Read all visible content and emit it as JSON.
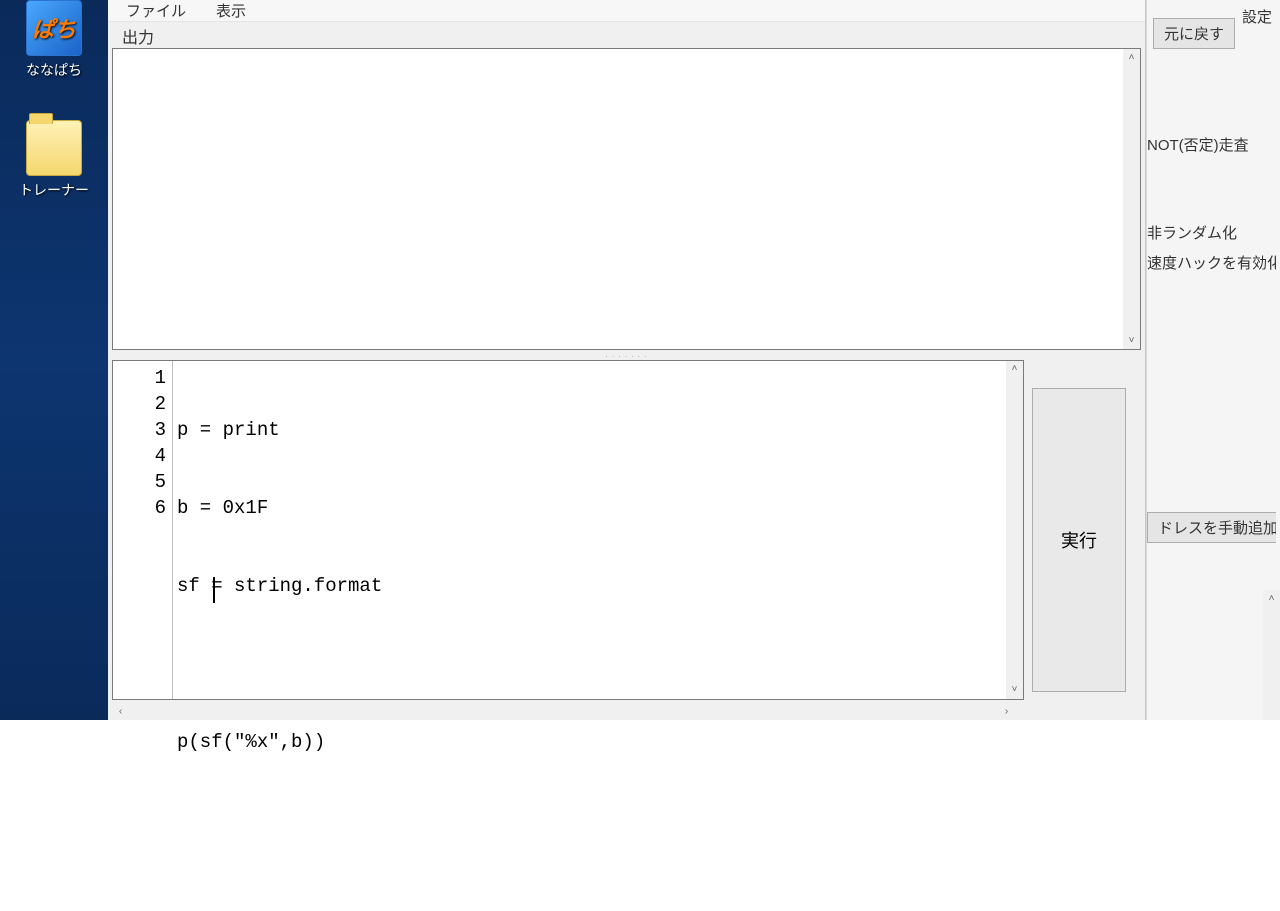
{
  "desktop": {
    "icons": [
      {
        "glyph_text": "ぱち",
        "label": "ななぱち"
      },
      {
        "label": "トレーナー"
      }
    ]
  },
  "editor": {
    "menu": {
      "file": "ファイル",
      "view": "表示"
    },
    "output_label": "出力",
    "code_lines": [
      "p = print",
      "b = 0x1F",
      "sf = string.format",
      "",
      "p(sf(\"%x\",b))",
      ""
    ],
    "exec_label": "実行",
    "splitter_dots": ". . . . . . ."
  },
  "bg": {
    "settings": "設定",
    "undo_btn": "元に戻す",
    "not_scan": "NOT(否定)走査",
    "nonrandom": "非ランダム化",
    "speedhack": "速度ハックを有効化",
    "addr_btn": "ドレスを手動追加"
  },
  "glyphs": {
    "up": "˄",
    "down": "˅",
    "left": "‹",
    "right": "›"
  }
}
